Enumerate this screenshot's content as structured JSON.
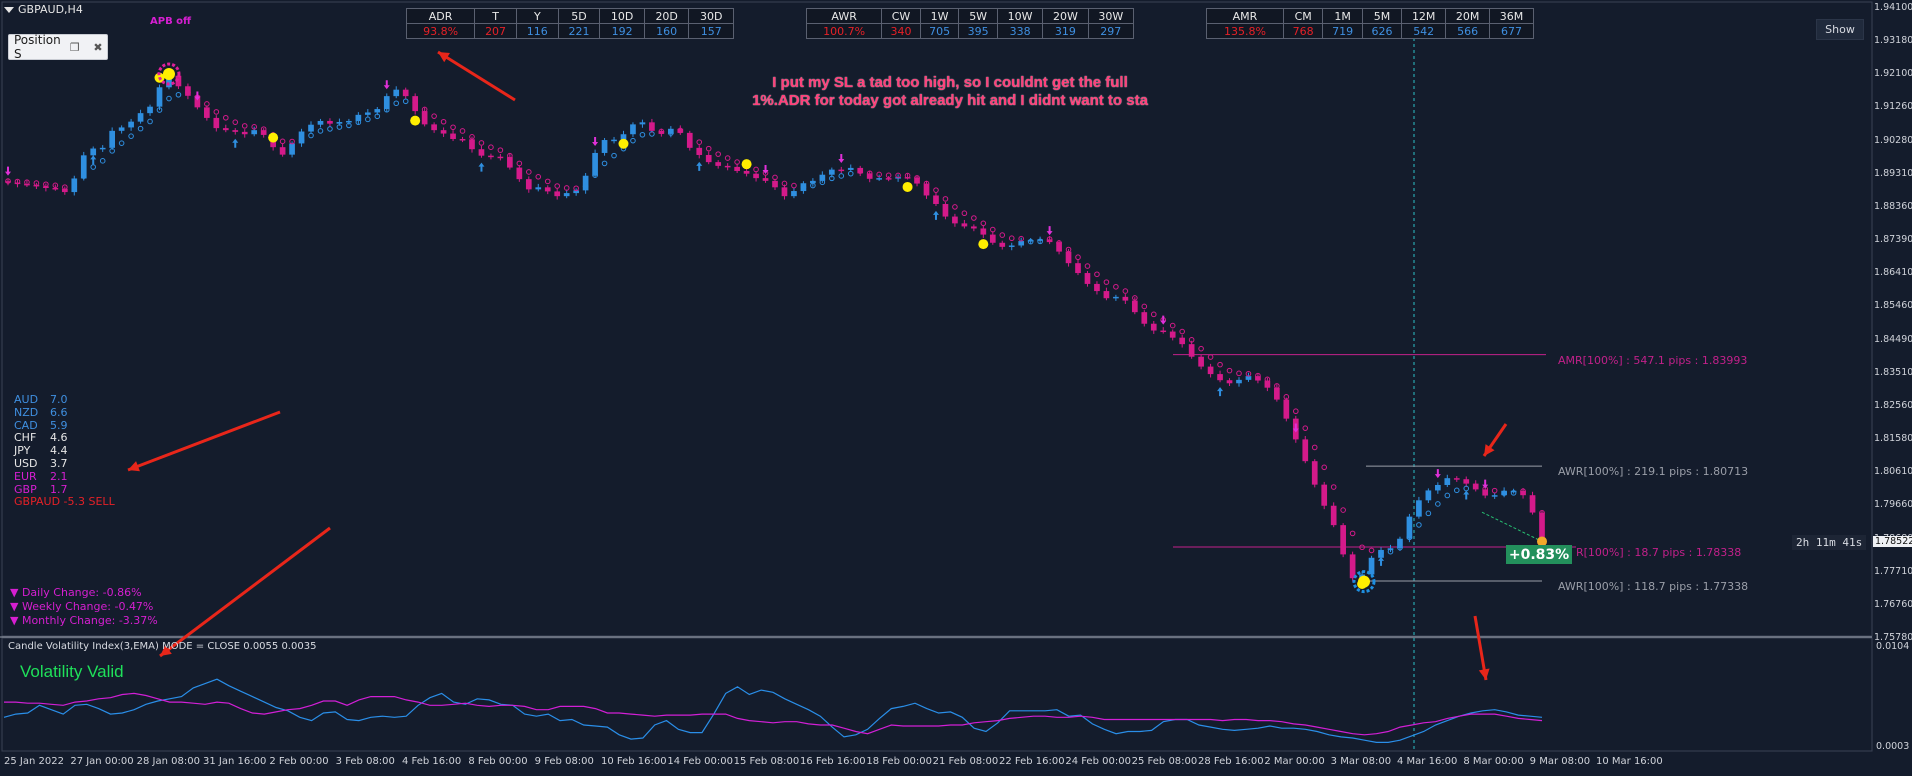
{
  "window": {
    "symbol_title": "GBPAUD,H4",
    "apb_label": "APB off",
    "position_panel_label": "Position S",
    "show_button": "Show"
  },
  "tables": {
    "adr": {
      "headers": [
        "ADR",
        "T",
        "Y",
        "5D",
        "10D",
        "20D",
        "30D"
      ],
      "values": [
        "93.8%",
        "207",
        "116",
        "221",
        "192",
        "160",
        "157"
      ],
      "value_colors": [
        "red",
        "red",
        "blue",
        "blue",
        "blue",
        "blue",
        "blue"
      ]
    },
    "awr": {
      "headers": [
        "AWR",
        "CW",
        "1W",
        "5W",
        "10W",
        "20W",
        "30W"
      ],
      "values": [
        "100.7%",
        "340",
        "705",
        "395",
        "338",
        "319",
        "297"
      ],
      "value_colors": [
        "red",
        "red",
        "blue",
        "blue",
        "blue",
        "blue",
        "blue"
      ]
    },
    "amr": {
      "headers": [
        "AMR",
        "CM",
        "1M",
        "5M",
        "12M",
        "20M",
        "36M"
      ],
      "values": [
        "135.8%",
        "768",
        "719",
        "626",
        "542",
        "566",
        "677"
      ],
      "value_colors": [
        "red",
        "red",
        "blue",
        "blue",
        "blue",
        "blue",
        "blue"
      ]
    }
  },
  "note": {
    "line1": "I put my SL a tad too high, so I couldnt get the full",
    "line2": "1%.ADR for today got already hit and I didnt want to sta"
  },
  "currency_strength": [
    {
      "code": "AUD",
      "value": "7.0",
      "color": "#3f8fe0"
    },
    {
      "code": "NZD",
      "value": "6.6",
      "color": "#3f8fe0"
    },
    {
      "code": "CAD",
      "value": "5.9",
      "color": "#3f8fe0"
    },
    {
      "code": "CHF",
      "value": "4.6",
      "color": "#e6e6e6"
    },
    {
      "code": "JPY",
      "value": "4.4",
      "color": "#e6e6e6"
    },
    {
      "code": "USD",
      "value": "3.7",
      "color": "#e6e6e6"
    },
    {
      "code": "EUR",
      "value": "2.1",
      "color": "#d61fd1"
    },
    {
      "code": "GBP",
      "value": "1.7",
      "color": "#d61fd1"
    }
  ],
  "pair_strength": {
    "label": "GBPAUD -5.3 SELL",
    "color": "#e52127"
  },
  "changes": {
    "daily": "▼  Daily Change: -0.86%",
    "weekly": "▼  Weekly Change: -0.47%",
    "monthly": "▼  Monthly Change: -3.37%"
  },
  "level_labels": {
    "amr": "AMR[100%] : 547.1 pips : 1.83993",
    "awr_high": "AWR[100%] : 219.1 pips : 1.80713",
    "adr_mid": "R[100%] : 18.7 pips : 1.78338",
    "awr_low": "AWR[100%] : 118.7 pips : 1.77338"
  },
  "pct_badge": "+0.83%",
  "timer": "2h 11m 41s",
  "current_price": "1.78522",
  "indicator": {
    "title": "Candle Volatility Index(3,EMA) MODE = CLOSE 0.0055 0.0035",
    "status": "Volatility Valid"
  },
  "colors": {
    "background": "#141c2c",
    "bull": "#2f8fe0",
    "bear": "#d41a8a",
    "ema_marker": "#d41a8a",
    "level_magenta": "#c2208a",
    "level_gray": "#9a9ea8",
    "arrow_red": "#e8261a",
    "signal_yellow": "#ffee00"
  },
  "chart_data": [
    {
      "type": "candlestick",
      "series_name": "GBPAUD,H4",
      "x_ticks": [
        "25 Jan 2022",
        "27 Jan 00:00",
        "28 Jan 08:00",
        "31 Jan 16:00",
        "2 Feb 00:00",
        "3 Feb 08:00",
        "4 Feb 16:00",
        "8 Feb 00:00",
        "9 Feb 08:00",
        "10 Feb 16:00",
        "14 Feb 00:00",
        "15 Feb 08:00",
        "16 Feb 16:00",
        "18 Feb 00:00",
        "21 Feb 08:00",
        "22 Feb 16:00",
        "24 Feb 00:00",
        "25 Feb 08:00",
        "28 Feb 16:00",
        "2 Mar 00:00",
        "3 Mar 08:00",
        "4 Mar 16:00",
        "8 Mar 00:00",
        "9 Mar 08:00",
        "10 Mar 16:00"
      ],
      "y_ticks": [
        "1.94100",
        "1.93180",
        "1.92100",
        "1.91260",
        "1.90280",
        "1.89310",
        "1.88360",
        "1.87390",
        "1.86410",
        "1.85460",
        "1.84490",
        "1.83510",
        "1.82560",
        "1.81580",
        "1.80610",
        "1.79660",
        "1.78680",
        "1.77710",
        "1.76760",
        "1.75780"
      ],
      "ylim": [
        1.7578,
        1.9421
      ],
      "close": [
        1.8905,
        1.8901,
        1.8898,
        1.8894,
        1.8889,
        1.8887,
        1.8877,
        1.8917,
        1.8985,
        1.9005,
        1.9007,
        1.9057,
        1.9067,
        1.9084,
        1.9109,
        1.9128,
        1.9185,
        1.9219,
        1.9188,
        1.916,
        1.9126,
        1.9095,
        1.9065,
        1.9059,
        1.9054,
        1.9047,
        1.9059,
        1.9045,
        1.9009,
        1.8987,
        1.902,
        1.9055,
        1.9075,
        1.9086,
        1.9078,
        1.9083,
        1.9086,
        1.9104,
        1.9111,
        1.9121,
        1.9159,
        1.9178,
        1.9159,
        1.9115,
        1.9076,
        1.9059,
        1.9049,
        1.9033,
        1.9032,
        1.9003,
        1.8984,
        1.8981,
        1.898,
        1.8949,
        1.8915,
        1.8885,
        1.8891,
        1.8879,
        1.8865,
        1.8874,
        1.8882,
        1.8925,
        1.8992,
        1.903,
        1.9031,
        1.9047,
        1.9076,
        1.9082,
        1.9057,
        1.9048,
        1.9063,
        1.9051,
        1.9007,
        1.8986,
        1.8965,
        1.8954,
        1.8951,
        1.8939,
        1.8931,
        1.8918,
        1.891,
        1.8891,
        1.8865,
        1.888,
        1.8903,
        1.891,
        1.8928,
        1.8943,
        1.8942,
        1.8948,
        1.8932,
        1.8916,
        1.8918,
        1.8917,
        1.8921,
        1.892,
        1.8902,
        1.8867,
        1.8842,
        1.8805,
        1.8785,
        1.8776,
        1.877,
        1.8752,
        1.8728,
        1.8716,
        1.872,
        1.8733,
        1.8736,
        1.8738,
        1.873,
        1.8702,
        1.8668,
        1.8639,
        1.8607,
        1.8586,
        1.8565,
        1.8569,
        1.8558,
        1.8524,
        1.849,
        1.847,
        1.8467,
        1.8449,
        1.843,
        1.8393,
        1.8364,
        1.8342,
        1.8324,
        1.8315,
        1.8325,
        1.8336,
        1.8323,
        1.8302,
        1.8267,
        1.8211,
        1.815,
        1.8086,
        1.8017,
        1.7955,
        1.7898,
        1.7812,
        1.7742,
        1.7753,
        1.7802,
        1.7825,
        1.783,
        1.7858,
        1.7923,
        1.7971,
        1.8,
        1.8016,
        1.8036,
        1.8033,
        1.802,
        1.8003,
        1.7985,
        1.7986,
        1.7999,
        1.7999,
        1.7986,
        1.7935,
        1.785
      ]
    },
    {
      "type": "line",
      "series_name": "Candle Volatility Index(3,EMA)",
      "y_ticks": [
        "0.0104",
        "0.0003"
      ],
      "ylim": [
        0.0003,
        0.0104
      ],
      "series": [
        {
          "values": [
            0.0033,
            0.0036,
            0.0037,
            0.0044,
            0.004,
            0.0036,
            0.0044,
            0.0045,
            0.0041,
            0.0036,
            0.0037,
            0.004,
            0.0045,
            0.0048,
            0.005,
            0.0052,
            0.006,
            0.0064,
            0.0068,
            0.0062,
            0.0057,
            0.0052,
            0.0047,
            0.0042,
            0.0039,
            0.0033,
            0.003,
            0.0037,
            0.0038,
            0.0031,
            0.003,
            0.0033,
            0.0034,
            0.0033,
            0.0034,
            0.0044,
            0.0051,
            0.0055,
            0.0047,
            0.0045,
            0.005,
            0.0049,
            0.0045,
            0.0044,
            0.0036,
            0.0034,
            0.0036,
            0.003,
            0.0031,
            0.0026,
            0.0025,
            0.0024,
            0.0017,
            0.0013,
            0.0014,
            0.0026,
            0.003,
            0.0022,
            0.0019,
            0.0019,
            0.0036,
            0.0055,
            0.0061,
            0.0054,
            0.0058,
            0.0056,
            0.005,
            0.0045,
            0.004,
            0.0034,
            0.0024,
            0.0015,
            0.0017,
            0.0022,
            0.0032,
            0.0041,
            0.0043,
            0.0046,
            0.0041,
            0.0037,
            0.0038,
            0.0033,
            0.0023,
            0.002,
            0.0028,
            0.0039,
            0.0039,
            0.0039,
            0.0039,
            0.004,
            0.0034,
            0.0035,
            0.0027,
            0.0022,
            0.0018,
            0.002,
            0.002,
            0.0021,
            0.0029,
            0.0031,
            0.0031,
            0.0026,
            0.0024,
            0.0022,
            0.0021,
            0.0022,
            0.0023,
            0.0025,
            0.0023,
            0.0023,
            0.0022,
            0.002,
            0.0017,
            0.0015,
            0.0014,
            0.0012,
            0.001,
            0.001,
            0.0012,
            0.0016,
            0.002,
            0.0026,
            0.003,
            0.0034,
            0.0037,
            0.0039,
            0.004,
            0.0038,
            0.0035,
            0.0034,
            0.0033
          ]
        },
        {
          "values": [
            0.0047,
            0.0047,
            0.0046,
            0.0046,
            0.0045,
            0.0044,
            0.0047,
            0.0048,
            0.005,
            0.0051,
            0.0054,
            0.0055,
            0.0053,
            0.005,
            0.0047,
            0.0047,
            0.0046,
            0.0045,
            0.0047,
            0.0046,
            0.0041,
            0.0037,
            0.0036,
            0.0038,
            0.004,
            0.0041,
            0.0044,
            0.0048,
            0.0048,
            0.0044,
            0.0049,
            0.0052,
            0.0052,
            0.0052,
            0.0049,
            0.0047,
            0.0044,
            0.0044,
            0.0045,
            0.0046,
            0.0044,
            0.0043,
            0.0044,
            0.0044,
            0.0043,
            0.004,
            0.004,
            0.0043,
            0.0043,
            0.0043,
            0.0041,
            0.0037,
            0.0037,
            0.0036,
            0.0035,
            0.0034,
            0.0035,
            0.0035,
            0.0035,
            0.0036,
            0.0036,
            0.0036,
            0.0032,
            0.003,
            0.0029,
            0.0028,
            0.0029,
            0.0029,
            0.0027,
            0.0026,
            0.0026,
            0.0023,
            0.002,
            0.0018,
            0.0022,
            0.0026,
            0.0025,
            0.0025,
            0.0025,
            0.0025,
            0.0026,
            0.0026,
            0.0028,
            0.0029,
            0.003,
            0.0032,
            0.0033,
            0.0034,
            0.0034,
            0.0033,
            0.0033,
            0.0034,
            0.0033,
            0.0031,
            0.0031,
            0.0031,
            0.0031,
            0.0031,
            0.0031,
            0.0031,
            0.0031,
            0.0031,
            0.0031,
            0.003,
            0.0031,
            0.0031,
            0.003,
            0.003,
            0.0029,
            0.0027,
            0.0026,
            0.0024,
            0.0022,
            0.002,
            0.0018,
            0.0017,
            0.0018,
            0.002,
            0.0024,
            0.0026,
            0.0028,
            0.0029,
            0.0032,
            0.0034,
            0.0036,
            0.0036,
            0.0036,
            0.0034,
            0.0032,
            0.0031,
            0.003
          ]
        }
      ]
    }
  ],
  "levels": {
    "amr": 1.83993,
    "awr_high": 1.80713,
    "adr_mid": 1.78338,
    "awr_low": 1.77338
  }
}
